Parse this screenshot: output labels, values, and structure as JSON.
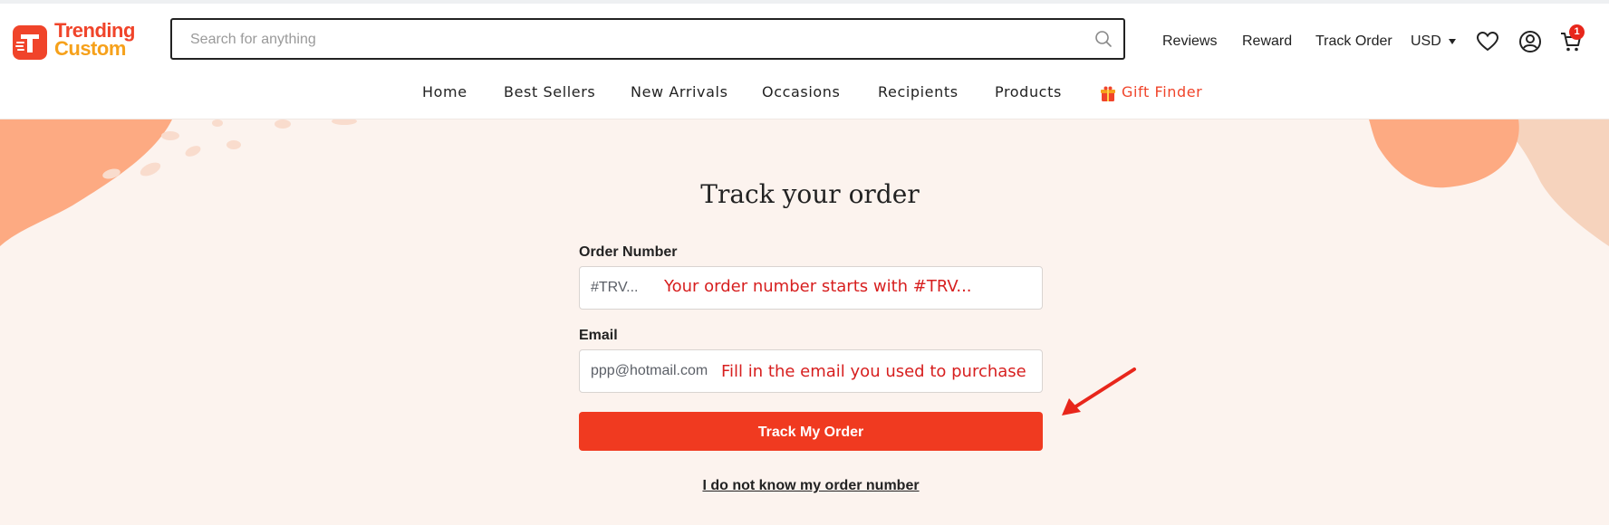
{
  "brand": {
    "logo_line1": "Trending",
    "logo_line2": "Custom",
    "primary_color": "#f0442a",
    "secondary_color": "#f6a11b"
  },
  "search": {
    "placeholder": "Search for anything",
    "icon": "search-icon"
  },
  "header_links": {
    "reviews": "Reviews",
    "reward": "Reward",
    "track_order": "Track Order",
    "currency": "USD",
    "wishlist_icon": "heart-icon",
    "account_icon": "user-icon",
    "cart_icon": "cart-icon",
    "cart_count": "1"
  },
  "main_nav": {
    "home": "Home",
    "best_sellers": "Best Sellers",
    "new_arrivals": "New Arrivals",
    "occasions": "Occasions",
    "recipients": "Recipients",
    "products": "Products",
    "gift_finder": "Gift Finder"
  },
  "track_form": {
    "title": "Track your order",
    "order_number_label": "Order Number",
    "order_number_value": "#TRV...",
    "order_number_hint": "Your order number starts with #TRV...",
    "email_label": "Email",
    "email_value": "ppp@hotmail.com",
    "email_hint": "Fill in the email you used to purchase",
    "submit_label": "Track My Order",
    "unknown_link": "I do not know my order number"
  },
  "colors": {
    "hero_background": "#fcf3ee",
    "button": "#f03a20",
    "annotation": "#d71f1f"
  }
}
